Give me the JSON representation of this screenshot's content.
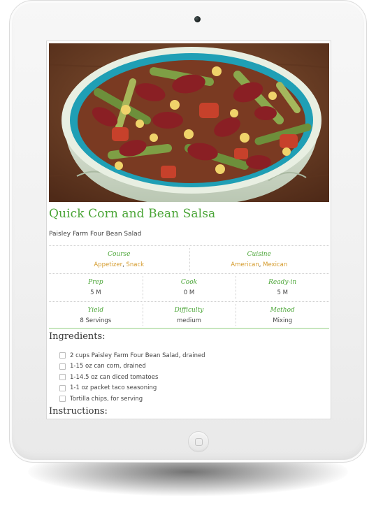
{
  "recipe": {
    "title": "Quick Corn and Bean Salsa",
    "subtitle": "Paisley Farm Four Bean Salad"
  },
  "meta": {
    "course": {
      "label": "Course",
      "values": [
        "Appetizer",
        "Snack"
      ]
    },
    "cuisine": {
      "label": "Cuisine",
      "values": [
        "American",
        "Mexican"
      ]
    },
    "prep": {
      "label": "Prep",
      "value": "5 M"
    },
    "cook": {
      "label": "Cook",
      "value": "0 M"
    },
    "ready_in": {
      "label": "Ready-in",
      "value": "5 M"
    },
    "yield": {
      "label": "Yield",
      "value": "8 Servings"
    },
    "difficulty": {
      "label": "Difficulty",
      "value": "medium"
    },
    "method": {
      "label": "Method",
      "value": "Mixing"
    }
  },
  "ingredients": {
    "heading": "Ingredients:",
    "items": [
      "2 cups Paisley Farm Four Bean Salad, drained",
      "1-15 oz can corn, drained",
      "1-14.5 oz can diced tomatoes",
      "1-1 oz packet taco seasoning",
      "Tortilla chips, for serving"
    ]
  },
  "instructions": {
    "heading": "Instructions:"
  },
  "icons": {
    "camera": "camera-icon",
    "home": "home-button-icon"
  },
  "colors": {
    "accent_green": "#4aa536",
    "link_orange": "#d49a2a",
    "bowl_teal": "#1f9fb5"
  }
}
